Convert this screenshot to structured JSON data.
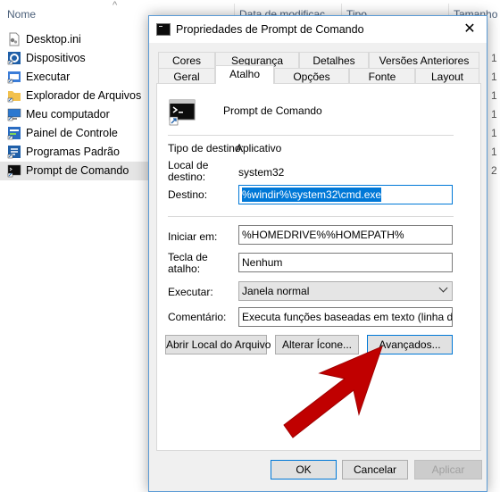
{
  "explorer": {
    "columns": {
      "name": "Nome",
      "date": "Data de modificaç",
      "type": "Tipo",
      "size": "Tamanho"
    },
    "files": [
      {
        "name": "Desktop.ini",
        "size": ""
      },
      {
        "name": "Dispositivos",
        "size": "1"
      },
      {
        "name": "Executar",
        "size": "1"
      },
      {
        "name": "Explorador de Arquivos",
        "size": "1"
      },
      {
        "name": "Meu computador",
        "size": "1"
      },
      {
        "name": "Painel de Controle",
        "size": "1"
      },
      {
        "name": "Programas Padrão",
        "size": "1"
      },
      {
        "name": "Prompt de Comando",
        "size": "2"
      }
    ]
  },
  "dialog": {
    "title": "Propriedades de Prompt de Comando",
    "tabs_back": [
      "Cores",
      "Segurança",
      "Detalhes",
      "Versões Anteriores"
    ],
    "tabs_front": [
      "Geral",
      "Atalho",
      "Opções",
      "Fonte",
      "Layout"
    ],
    "active_tab": "Atalho",
    "shortcut_name": "Prompt de Comando",
    "labels": {
      "target_type": "Tipo de destino:",
      "target_location": "Local de destino:",
      "target": "Destino:",
      "start_in": "Iniciar em:",
      "shortcut_key": "Tecla de atalho:",
      "run": "Executar:",
      "comment": "Comentário:"
    },
    "values": {
      "target_type": "Aplicativo",
      "target_location": "system32",
      "target": "%windir%\\system32\\cmd.exe",
      "start_in": "%HOMEDRIVE%%HOMEPATH%",
      "shortcut_key": "Nenhum",
      "run": "Janela normal",
      "comment": "Executa funções baseadas em texto (linha de con"
    },
    "buttons": {
      "open_location": "Abrir Local do Arquivo",
      "change_icon": "Alterar Ícone...",
      "advanced": "Avançados...",
      "ok": "OK",
      "cancel": "Cancelar",
      "apply": "Aplicar"
    }
  },
  "colors": {
    "accent": "#0078d7",
    "arrow": "#c00000"
  }
}
